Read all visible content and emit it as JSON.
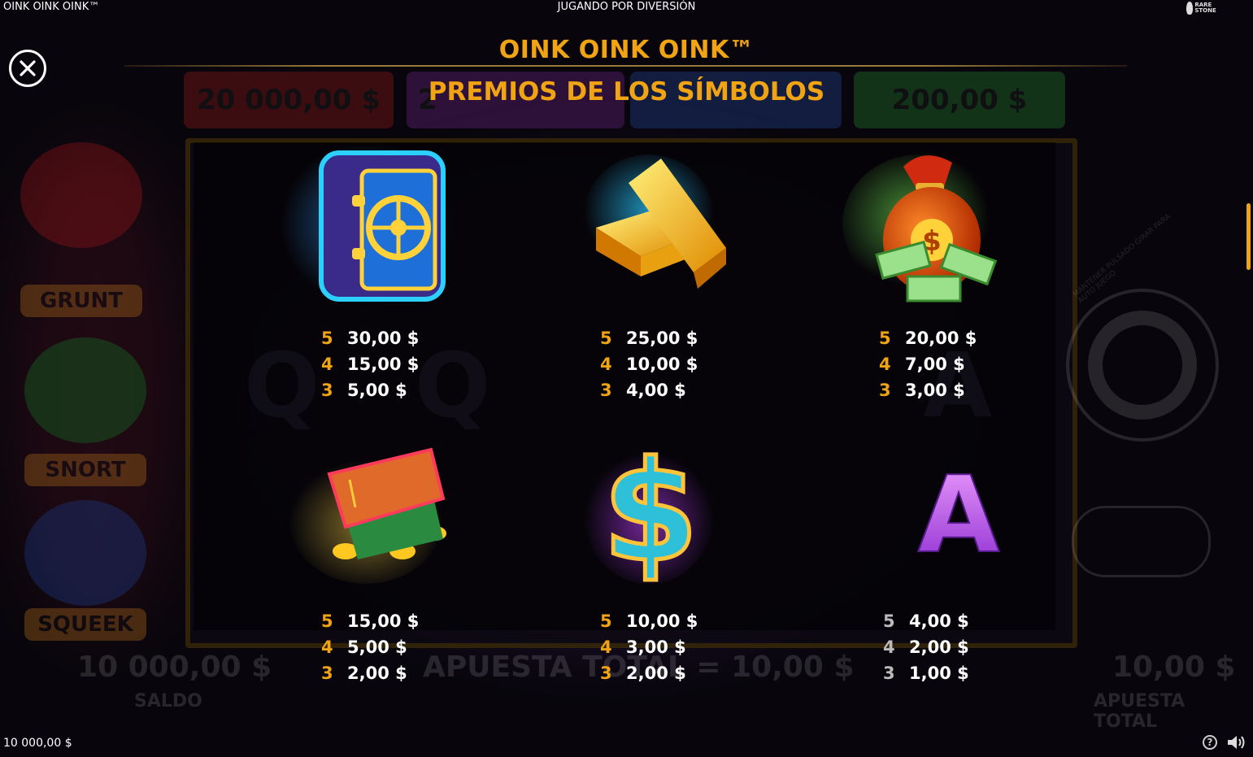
{
  "topbar": {
    "game_title": "OINK OINK OINK™",
    "play_mode": "JUGANDO POR DIVERSIÓN",
    "brand_logo_text": "RARE STONE"
  },
  "paytable": {
    "title": "OINK OINK OINK™",
    "section_title": "PREMIOS DE LOS SÍMBOLOS"
  },
  "symbols": [
    {
      "name": "vault",
      "pays": [
        {
          "count": "5",
          "value": "30,00 $"
        },
        {
          "count": "4",
          "value": "15,00 $"
        },
        {
          "count": "3",
          "value": "5,00 $"
        }
      ]
    },
    {
      "name": "gold-bars",
      "pays": [
        {
          "count": "5",
          "value": "25,00 $"
        },
        {
          "count": "4",
          "value": "10,00 $"
        },
        {
          "count": "3",
          "value": "4,00 $"
        }
      ]
    },
    {
      "name": "money-bag",
      "pays": [
        {
          "count": "5",
          "value": "20,00 $"
        },
        {
          "count": "4",
          "value": "7,00 $"
        },
        {
          "count": "3",
          "value": "3,00 $"
        }
      ]
    },
    {
      "name": "wallet",
      "pays": [
        {
          "count": "5",
          "value": "15,00 $"
        },
        {
          "count": "4",
          "value": "5,00 $"
        },
        {
          "count": "3",
          "value": "2,00 $"
        }
      ]
    },
    {
      "name": "dollar-sign",
      "pays": [
        {
          "count": "5",
          "value": "10,00 $"
        },
        {
          "count": "4",
          "value": "3,00 $"
        },
        {
          "count": "3",
          "value": "2,00 $"
        }
      ]
    },
    {
      "name": "letter-a",
      "letter": "A",
      "pays": [
        {
          "count": "5",
          "value": "4,00 $"
        },
        {
          "count": "4",
          "value": "2,00 $"
        },
        {
          "count": "3",
          "value": "1,00 $"
        }
      ]
    }
  ],
  "background": {
    "jackpot_left": "20 000,00 $",
    "jackpot_mid": "2",
    "jackpot_right": "200,00 $",
    "balance_value": "10 000,00 $",
    "balance_label": "SALDO",
    "bet_text": "APUESTA TOTAL = 10,00 $",
    "bet_value": "10,00 $",
    "bet_label": "APUESTA TOTAL",
    "pig_labels": [
      "GRUNT",
      "SNORT",
      "SQUEEK"
    ],
    "autoplay_hint": "MANTENER PULSADO GIRAR PARA AUTO JUEGO",
    "reel_letters": [
      "Q",
      "Q",
      "A"
    ]
  },
  "footer": {
    "balance": "10 000,00 $"
  },
  "colors": {
    "accent": "#f0a313",
    "background": "#08060c"
  }
}
